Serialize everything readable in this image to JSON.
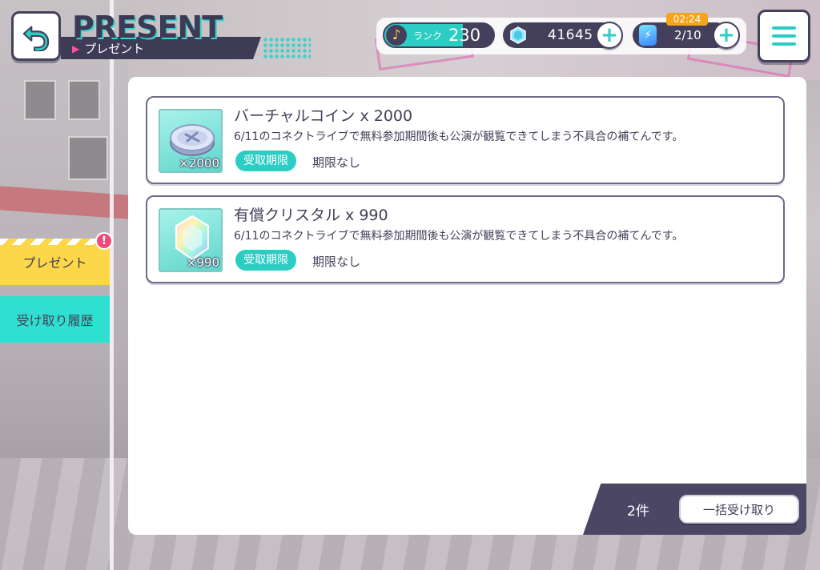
{
  "header": {
    "title_en": "PRESENT",
    "title_jp": "プレゼント"
  },
  "status": {
    "rank_label": "ランク",
    "rank_value": "230",
    "crystals": "41645",
    "stamina": "2/10",
    "stamina_timer": "02:24"
  },
  "sidebar": {
    "tabs": [
      {
        "label": "プレゼント",
        "selected": true,
        "badge": "!"
      },
      {
        "label": "受け取り履歴",
        "selected": false
      }
    ]
  },
  "items": [
    {
      "name": "バーチャルコイン x 2000",
      "description": "6/11のコネクトライブで無料参加期間後も公演が観覧できてしまう不具合の補てんです。",
      "thumb_qty": "×2000",
      "deadline_label": "受取期限",
      "deadline_value": "期限なし",
      "icon": "coin-icon"
    },
    {
      "name": "有償クリスタル x 990",
      "description": "6/11のコネクトライブで無料参加期間後も公演が観覧できてしまう不具合の補てんです。",
      "thumb_qty": "×990",
      "deadline_label": "受取期限",
      "deadline_value": "期限なし",
      "icon": "crystal-icon"
    }
  ],
  "footer": {
    "count": "2件",
    "claim_all_label": "一括受け取り"
  },
  "colors": {
    "accent": "#2ccdc2",
    "dark": "#43405a",
    "tab_selected": "#fcd749",
    "tab_other": "#2ee0d0",
    "badge": "#f04a7b",
    "timer": "#f6a41b"
  }
}
